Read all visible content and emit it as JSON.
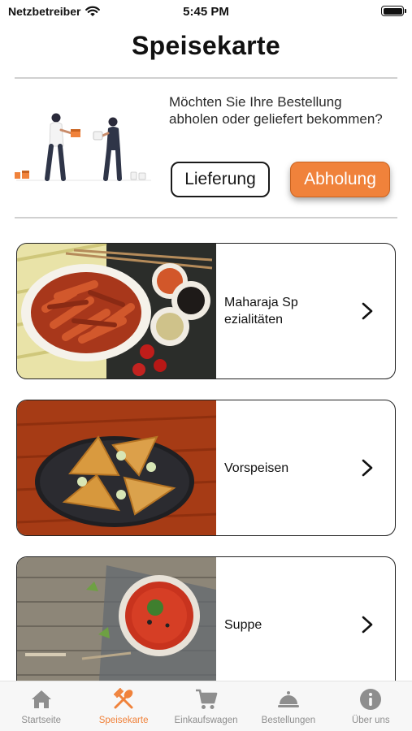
{
  "status_bar": {
    "carrier": "Netzbetreiber",
    "time": "5:45 PM",
    "wifi_icon": "wifi-icon",
    "battery_icon": "battery-icon"
  },
  "header": {
    "title": "Speisekarte"
  },
  "order_choice": {
    "question": "Möchten Sie Ihre Bestellung abholen oder geliefert bekommen?",
    "delivery_label": "Lieferung",
    "pickup_label": "Abholung",
    "selected": "Abholung",
    "accent_color": "#f0823b"
  },
  "categories": [
    {
      "label": "Maharaja Sp\nezialitäten",
      "image": "food-photo-maharaja",
      "icon": "chevron-right-icon"
    },
    {
      "label": "Vorspeisen",
      "image": "food-photo-samosa",
      "icon": "chevron-right-icon"
    },
    {
      "label": "Suppe",
      "image": "food-photo-tomato-soup",
      "icon": "chevron-right-icon"
    }
  ],
  "tabbar": {
    "active": "Speisekarte",
    "items": [
      {
        "label": "Startseite",
        "icon": "home-icon"
      },
      {
        "label": "Speisekarte",
        "icon": "fork-spoon-icon"
      },
      {
        "label": "Einkaufswagen",
        "icon": "cart-icon"
      },
      {
        "label": "Bestellungen",
        "icon": "cloche-icon"
      },
      {
        "label": "Über uns",
        "icon": "info-icon"
      }
    ]
  }
}
